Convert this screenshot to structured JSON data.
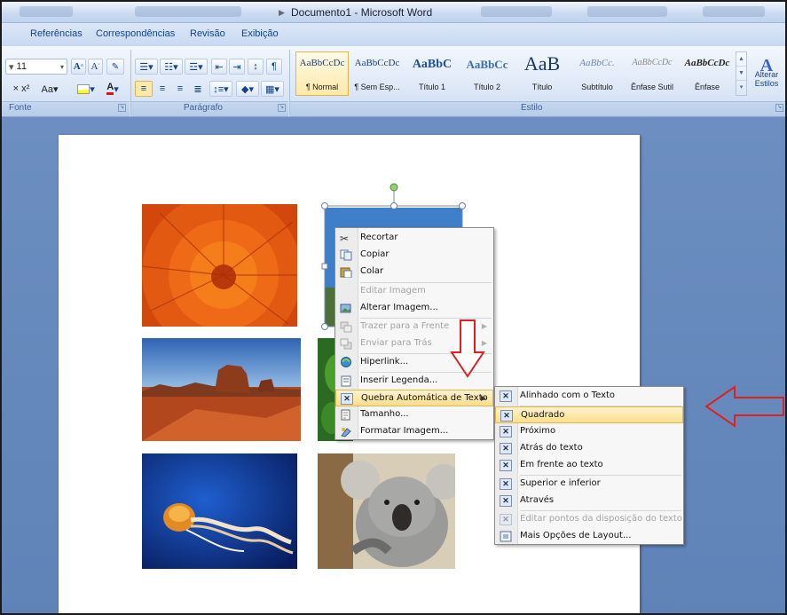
{
  "window": {
    "title": "Documento1 - Microsoft Word"
  },
  "tabs": [
    "Referências",
    "Correspondências",
    "Revisão",
    "Exibição"
  ],
  "ribbon": {
    "font_size": "11",
    "groups": {
      "font": "Fonte",
      "paragraph": "Parágrafo",
      "style": "Estilo"
    },
    "styles": [
      {
        "sample": "AaBbCcDc",
        "name": "¶ Normal"
      },
      {
        "sample": "AaBbCcDc",
        "name": "¶ Sem Esp..."
      },
      {
        "sample": "AaBbC",
        "name": "Título 1"
      },
      {
        "sample": "AaBbCc",
        "name": "Título 2"
      },
      {
        "sample": "AaB",
        "name": "Título"
      },
      {
        "sample": "AaBbCc.",
        "name": "Subtítulo"
      },
      {
        "sample": "AaBbCcDc",
        "name": "Ênfase Sutil"
      },
      {
        "sample": "AaBbCcDc",
        "name": "Ênfase"
      }
    ],
    "change_styles": "Alterar Estilos"
  },
  "context_menu": {
    "items": [
      {
        "label": "Recortar",
        "icon": "scissors-icon",
        "disabled": false
      },
      {
        "label": "Copiar",
        "icon": "copy-icon",
        "disabled": false
      },
      {
        "label": "Colar",
        "icon": "paste-icon",
        "disabled": false
      },
      {
        "label": "Editar Imagem",
        "icon": "",
        "disabled": true
      },
      {
        "label": "Alterar Imagem...",
        "icon": "change-picture-icon",
        "disabled": false
      },
      {
        "label": "Trazer para a Frente",
        "icon": "bring-forward-icon",
        "disabled": true,
        "submenu": true
      },
      {
        "label": "Enviar para Trás",
        "icon": "send-backward-icon",
        "disabled": true,
        "submenu": true
      },
      {
        "label": "Hiperlink...",
        "icon": "hyperlink-icon",
        "disabled": false
      },
      {
        "label": "Inserir Legenda...",
        "icon": "caption-icon",
        "disabled": false
      },
      {
        "label": "Quebra Automática de Texto",
        "icon": "text-wrap-icon",
        "disabled": false,
        "submenu": true,
        "highlighted": true
      },
      {
        "label": "Tamanho...",
        "icon": "size-icon",
        "disabled": false
      },
      {
        "label": "Formatar Imagem...",
        "icon": "format-picture-icon",
        "disabled": false
      }
    ]
  },
  "wrap_submenu": {
    "items": [
      {
        "label": "Alinhado com o Texto",
        "disabled": false
      },
      {
        "label": "Quadrado",
        "disabled": false,
        "highlighted": true
      },
      {
        "label": "Próximo",
        "disabled": false
      },
      {
        "label": "Atrás do texto",
        "disabled": false
      },
      {
        "label": "Em frente ao texto",
        "disabled": false
      },
      {
        "label": "Superior e inferior",
        "disabled": false
      },
      {
        "label": "Através",
        "disabled": false
      },
      {
        "label": "Editar pontos da disposição do texto",
        "disabled": true
      },
      {
        "label": "Mais Opções de Layout...",
        "disabled": false
      }
    ]
  },
  "annotations": {
    "arrow_color": "#e02020"
  },
  "colors": {
    "ribbon_text": "#15428b",
    "menu_highlight": "#fbde8b",
    "document_bg": "#6c8ec0"
  }
}
